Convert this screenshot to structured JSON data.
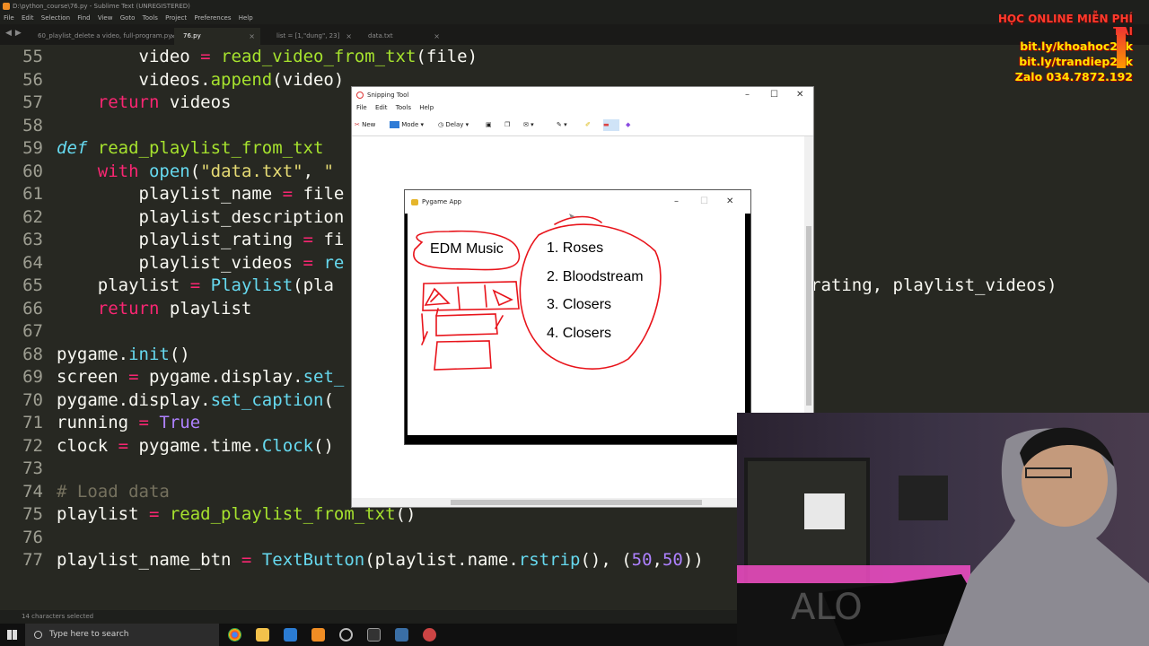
{
  "window": {
    "title": "D:\\python_course\\76.py - Sublime Text (UNREGISTERED)"
  },
  "menu": [
    "File",
    "Edit",
    "Selection",
    "Find",
    "View",
    "Goto",
    "Tools",
    "Project",
    "Preferences",
    "Help"
  ],
  "tabs": [
    {
      "label": "60_playlist_delete a video, full-program.py",
      "active": false
    },
    {
      "label": "76.py",
      "active": true
    },
    {
      "label": "list = [1,\"dung\", 23]",
      "active": false
    },
    {
      "label": "data.txt",
      "active": false
    }
  ],
  "code": {
    "lines": [
      "55",
      "56",
      "57",
      "58",
      "59",
      "60",
      "61",
      "62",
      "63",
      "64",
      "65",
      "66",
      "67",
      "68",
      "69",
      "70",
      "71",
      "72",
      "73",
      "74",
      "75",
      "76",
      "77"
    ],
    "l55a": "        video ",
    "l55b": "=",
    "l55c": " ",
    "l55d": "read_video_from_txt",
    "l55e": "(file)",
    "l56a": "        videos.",
    "l56b": "append",
    "l56c": "(video)",
    "l57a": "    ",
    "l57b": "return",
    "l57c": " videos",
    "l59a": "def",
    "l59b": " ",
    "l59c": "read_playlist_from_txt",
    "l60a": "    ",
    "l60b": "with",
    "l60c": " ",
    "l60d": "open",
    "l60e": "(",
    "l60f": "\"data.txt\"",
    "l60g": ", ",
    "l60h": "\"",
    "l61a": "        playlist_name ",
    "l61b": "=",
    "l61c": " file",
    "l62a": "        playlist_description",
    "l63a": "        playlist_rating ",
    "l63b": "=",
    "l63c": " fi",
    "l64a": "        playlist_videos ",
    "l64b": "=",
    "l64c": " re",
    "l65a": "    playlist ",
    "l65b": "=",
    "l65c": " ",
    "l65d": "Playlist",
    "l65e": "(pla",
    "l65f": "rating, playlist_videos)",
    "l66a": "    ",
    "l66b": "return",
    "l66c": " playlist",
    "l68a": "pygame.",
    "l68b": "init",
    "l68c": "()",
    "l69a": "screen ",
    "l69b": "=",
    "l69c": " pygame.display.",
    "l69d": "set_",
    "l70a": "pygame.display.",
    "l70b": "set_caption",
    "l70c": "(",
    "l71a": "running ",
    "l71b": "=",
    "l71c": " ",
    "l71d": "True",
    "l72a": "clock ",
    "l72b": "=",
    "l72c": " pygame.time.",
    "l72d": "Clock",
    "l72e": "()",
    "l74": "# Load data",
    "l75a": "playlist ",
    "l75b": "=",
    "l75c": " ",
    "l75d": "read_playlist_from_txt",
    "l75e": "()",
    "l77a": "playlist_name_btn ",
    "l77b": "=",
    "l77c": " ",
    "l77d": "TextButton",
    "l77e": "(playlist.name.",
    "l77f": "rstrip",
    "l77g": "(), (",
    "l77h": "50",
    "l77i": ",",
    "l77j": "50",
    "l77k": "))"
  },
  "status": "14 characters selected",
  "taskbar": {
    "search_placeholder": "Type here to search"
  },
  "snip": {
    "title": "Snipping Tool",
    "menu": [
      "File",
      "Edit",
      "Tools",
      "Help"
    ],
    "new": "New",
    "mode": "Mode",
    "delay": "Delay"
  },
  "pygame": {
    "title": "Pygame App",
    "playlist_title": "EDM Music",
    "songs": [
      "1. Roses",
      "2. Bloodstream",
      "3. Closers",
      "4. Closers"
    ]
  },
  "brand": {
    "line1": "HỌC ONLINE MIỄN PHÍ TẠI",
    "line2": "bit.ly/khoahoc20k",
    "line3": "bit.ly/trandiep20k",
    "line4": "Zalo 034.7872.192"
  },
  "colors": {
    "keyword": "#f92672",
    "function": "#a6e22e",
    "string": "#e6db74",
    "number": "#ae81ff",
    "builtin": "#66d9ef",
    "annotation": "#e8141b",
    "brand": "#ffe600"
  }
}
